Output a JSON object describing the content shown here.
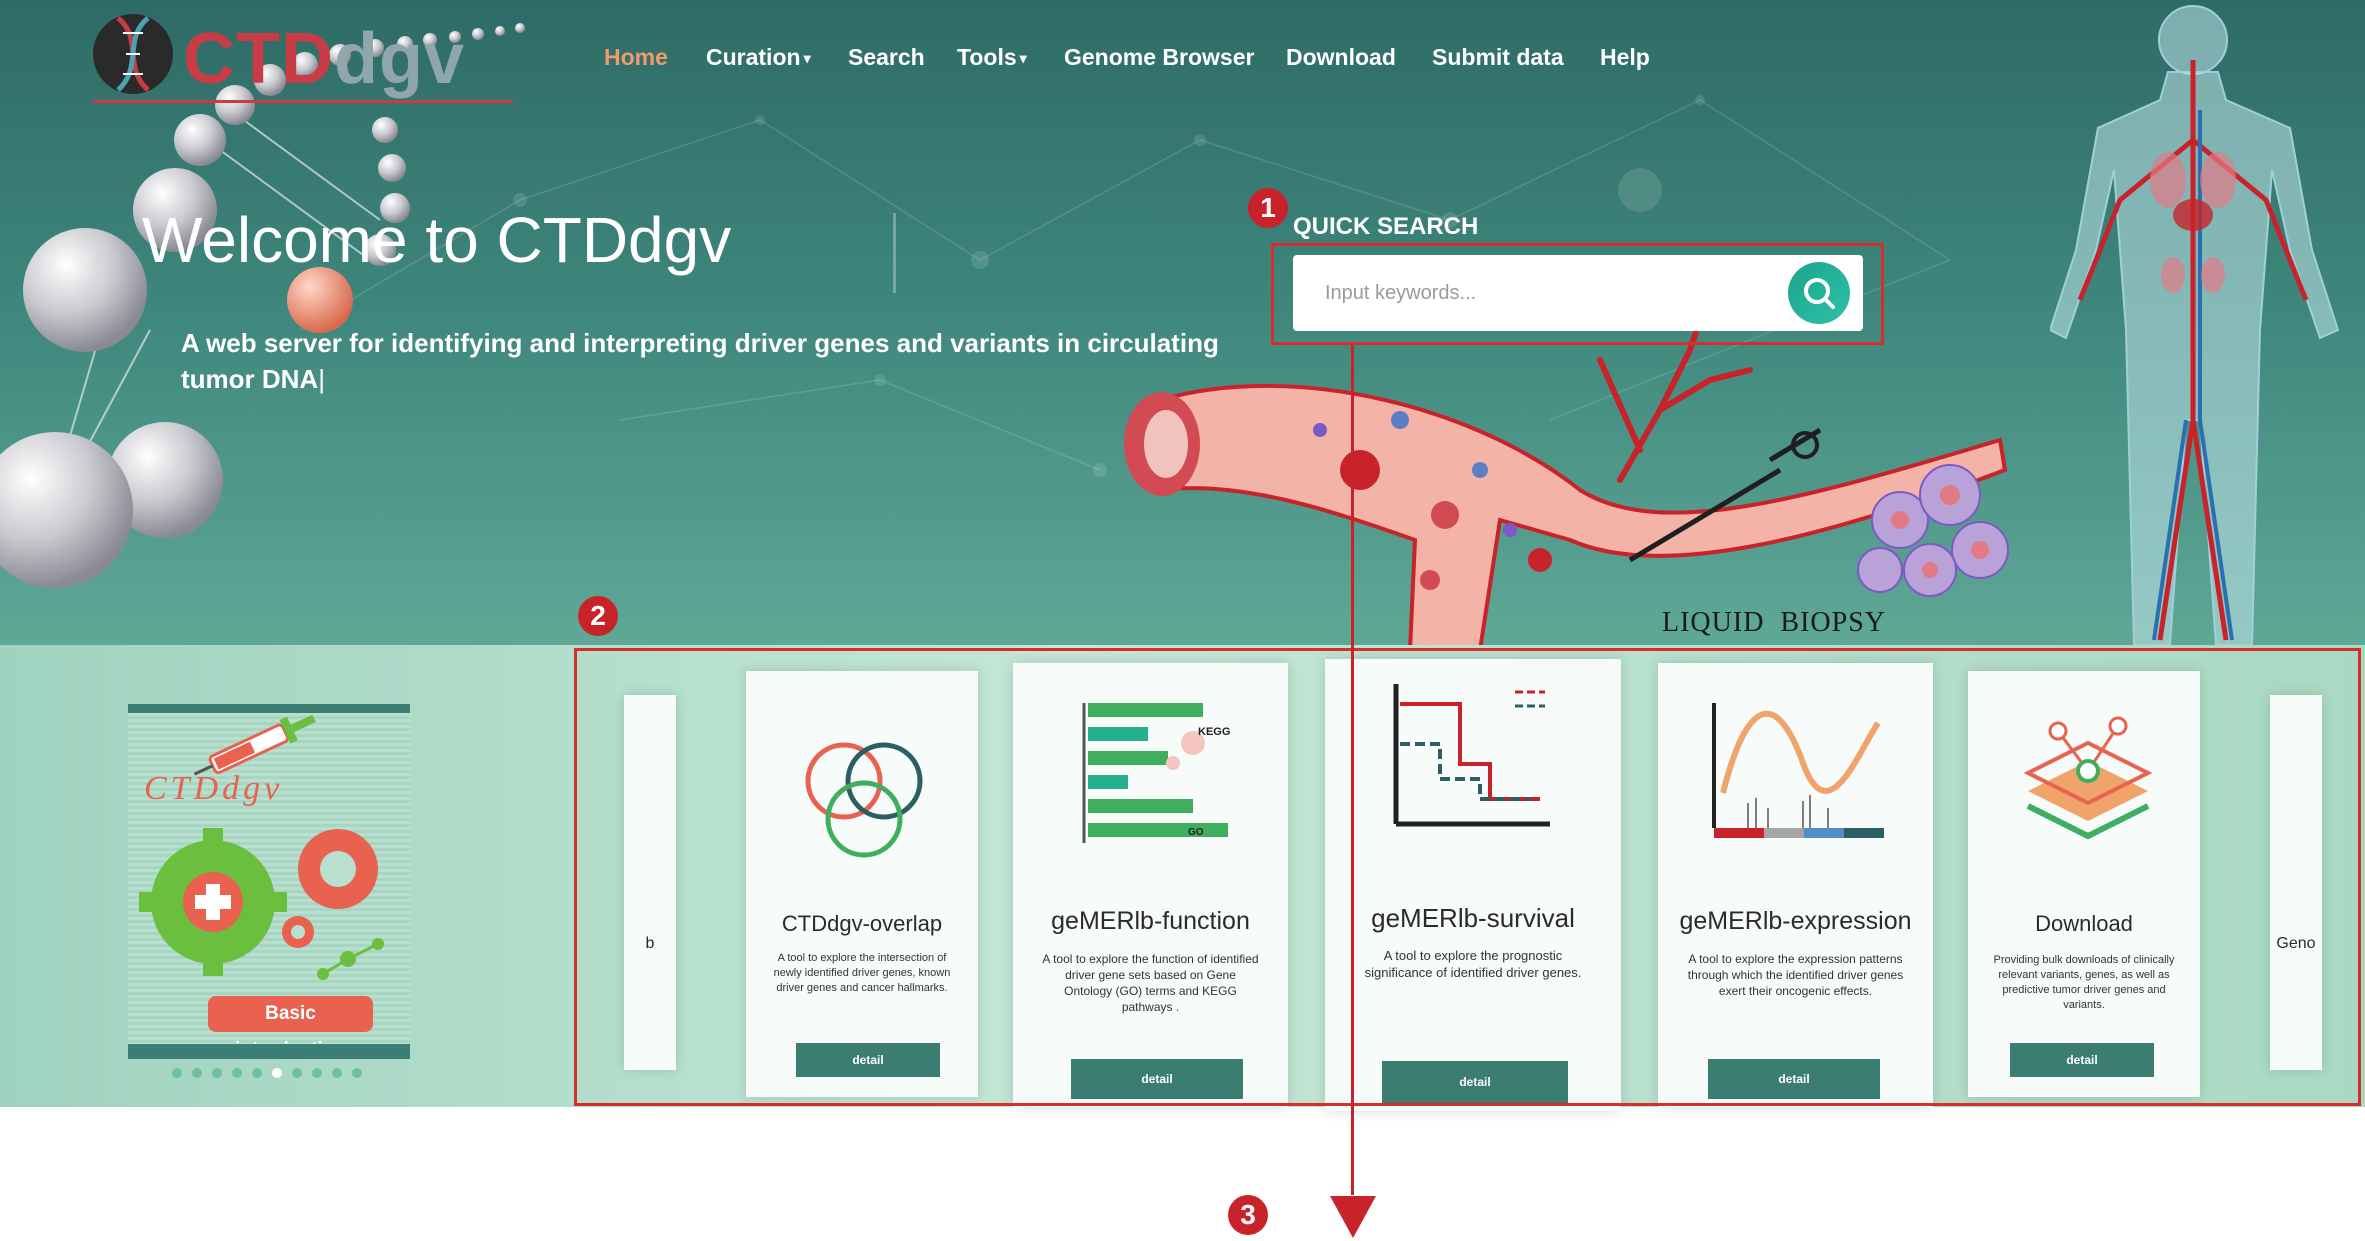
{
  "logo": {
    "part1": "CTD",
    "part2": "dgv"
  },
  "nav": [
    {
      "label": "Home",
      "active": true,
      "dropdown": false
    },
    {
      "label": "Curation",
      "active": false,
      "dropdown": true
    },
    {
      "label": "Search",
      "active": false,
      "dropdown": false
    },
    {
      "label": "Tools",
      "active": false,
      "dropdown": true
    },
    {
      "label": "Genome Browser",
      "active": false,
      "dropdown": false
    },
    {
      "label": "Download",
      "active": false,
      "dropdown": false
    },
    {
      "label": "Submit data",
      "active": false,
      "dropdown": false
    },
    {
      "label": "Help",
      "active": false,
      "dropdown": false
    }
  ],
  "hero": {
    "title": "Welcome to CTDdgv",
    "subtitle_line1": "A web server for identifying and interpreting driver genes and variants in circulating",
    "subtitle_line2": "tumor DNA",
    "caret": "|",
    "image_caption_1": "LIQUID",
    "image_caption_2": "BIOPSY"
  },
  "quick_search": {
    "label": "QUICK SEARCH",
    "placeholder": "Input keywords...",
    "button_icon": "search-icon"
  },
  "markers": {
    "m1": "1",
    "m2": "2",
    "m3": "3"
  },
  "intro": {
    "book_title": "CTDdgv",
    "button_label": "Basic introduction",
    "dot_count": 10,
    "active_dot": 5
  },
  "carousel": {
    "cards": [
      {
        "title": "b",
        "desc": ""
      },
      {
        "title": "CTDdgv-overlap",
        "desc": "A tool to explore the intersection of newly identified driver genes, known driver genes and cancer hallmarks.",
        "button": "detail"
      },
      {
        "title": "geMERlb-function",
        "desc": "A tool to explore the function of identified driver gene sets based on Gene Ontology (GO) terms and KEGG pathways .",
        "button": "detail",
        "graphic_labels": [
          "KEGG",
          "GO"
        ]
      },
      {
        "title": "geMERlb-survival",
        "desc": "A tool to explore the prognostic significance of identified driver genes.",
        "button": "detail"
      },
      {
        "title": "geMERlb-expression",
        "desc": "A tool to explore the expression patterns through which the identified driver genes exert their oncogenic effects.",
        "button": "detail"
      },
      {
        "title": "Download",
        "desc": "Providing bulk downloads of clinically relevant variants, genes, as well as predictive tumor driver genes and variants.",
        "button": "detail"
      },
      {
        "title": "Geno",
        "desc": ""
      }
    ]
  },
  "colors": {
    "accent_red": "#c8232b",
    "teal_dark": "#3c7d72",
    "nav_active": "#f19a6a",
    "logo_red": "#c83c45"
  }
}
